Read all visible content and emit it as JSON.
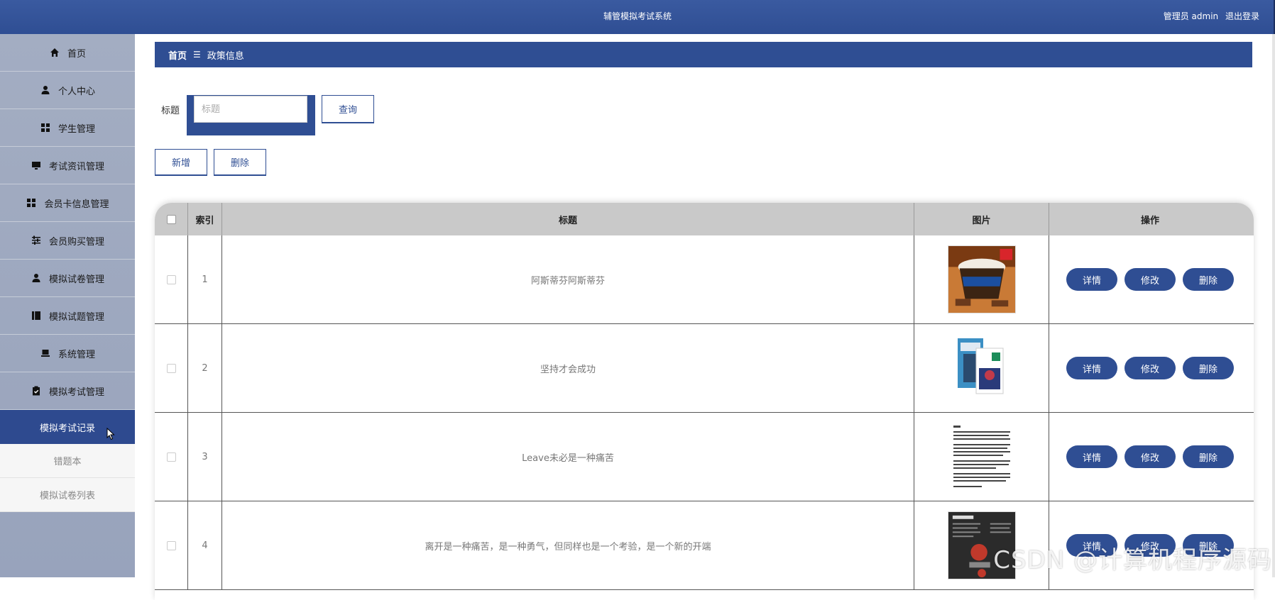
{
  "header": {
    "title": "辅管模拟考试系统",
    "user_label": "管理员 admin",
    "logout_label": "退出登录"
  },
  "sidebar": {
    "items": [
      {
        "label": "首页",
        "icon": "home-icon"
      },
      {
        "label": "个人中心",
        "icon": "user-icon"
      },
      {
        "label": "学生管理",
        "icon": "grid-icon"
      },
      {
        "label": "考试资讯管理",
        "icon": "monitor-icon"
      },
      {
        "label": "会员卡信息管理",
        "icon": "grid-icon"
      },
      {
        "label": "会员购买管理",
        "icon": "sliders-icon"
      },
      {
        "label": "模拟试卷管理",
        "icon": "user-icon"
      },
      {
        "label": "模拟试题管理",
        "icon": "book-icon"
      },
      {
        "label": "系统管理",
        "icon": "laptop-icon"
      },
      {
        "label": "模拟考试管理",
        "icon": "clipboard-icon"
      }
    ],
    "subitems": [
      {
        "label": "模拟考试记录",
        "active": true
      },
      {
        "label": "错题本",
        "active": false
      },
      {
        "label": "模拟试卷列表",
        "active": false
      }
    ]
  },
  "breadcrumb": {
    "home": "首页",
    "separator": "☰",
    "current": "政策信息"
  },
  "search": {
    "label": "标题",
    "placeholder": "标题",
    "value": "",
    "query_button": "查询"
  },
  "actions": {
    "add_button": "新增",
    "delete_button": "删除"
  },
  "table": {
    "headers": {
      "index": "索引",
      "title": "标题",
      "image": "图片",
      "operations": "操作"
    },
    "rows": [
      {
        "index": "1",
        "title": "阿斯蒂芬阿斯蒂芬",
        "image": "chocolate-bucket-image"
      },
      {
        "index": "2",
        "title": "坚持才会成功",
        "image": "magazine-covers-image"
      },
      {
        "index": "3",
        "title": "Leave未必是一种痛苦",
        "image": "text-document-image"
      },
      {
        "index": "4",
        "title": "离开是一种痛苦，是一种勇气，但同样也是一个考验，是一个新的开端",
        "image": "dark-infographic-image"
      }
    ],
    "row_buttons": {
      "detail": "详情",
      "edit": "修改",
      "delete": "删除"
    }
  },
  "watermark": "CSDN @计算机程序源码",
  "colors": {
    "primary": "#2f4e93",
    "sidebar": "#a3adc2",
    "table_header": "#c9c9c9"
  }
}
